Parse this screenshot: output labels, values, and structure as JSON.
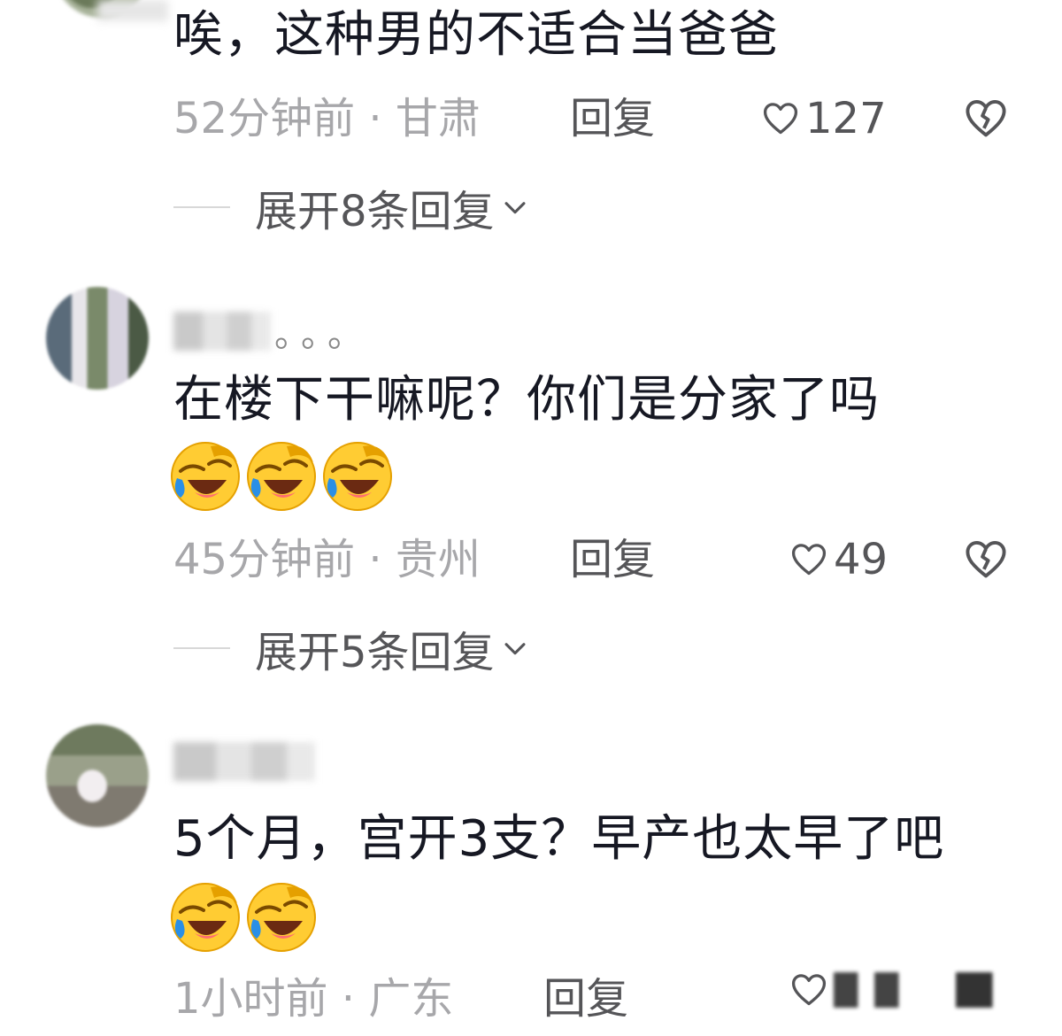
{
  "comments": [
    {
      "username_suffix": "",
      "text": "唉，这种男的不适合当爸爸",
      "emoji_count": 0,
      "time": "52分钟前 · 甘肃",
      "reply_label": "回复",
      "likes": "127",
      "expand_label": "展开8条回复"
    },
    {
      "username_suffix": "。。。",
      "text": "在楼下干嘛呢？你们是分家了吗",
      "emoji_count": 3,
      "time": "45分钟前 · 贵州",
      "reply_label": "回复",
      "likes": "49",
      "expand_label": "展开5条回复"
    },
    {
      "username_suffix": "",
      "text": "5个月，宫开3支？早产也太早了吧",
      "emoji_count": 2,
      "time": "1小时前 · 广东",
      "reply_label": "回复",
      "likes": ""
    }
  ],
  "icons": {
    "like": "heart-outline-icon",
    "dislike": "broken-heart-icon",
    "expand": "chevron-down-icon",
    "emoji": "laughing-crying-emoji"
  },
  "colors": {
    "text": "#161823",
    "meta": "#a7a7aa",
    "action": "#555558"
  }
}
